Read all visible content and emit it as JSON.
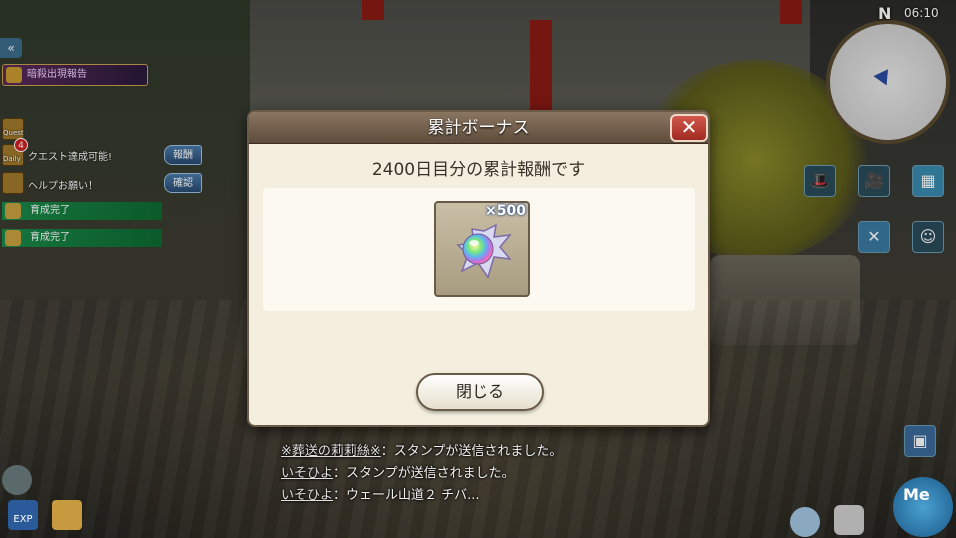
{
  "hud": {
    "clock": "06:10",
    "compass_label": "N",
    "collapse_glyph": "«",
    "event_banner": "暗殺出現報告",
    "quest_icon_label": "Quest",
    "daily_icon_label": "Daily",
    "daily_badge": "4",
    "quest_status": "クエスト達成可能!",
    "help_text": "ヘルプお願い！",
    "report_tag": "報酬",
    "confirm_tag": "確認",
    "training_items": [
      "育成完了",
      "育成完了"
    ],
    "exp_label": "EXP",
    "me_label": "Me"
  },
  "dialog": {
    "title": "累計ボーナス",
    "close_glyph": "✕",
    "subtitle": "2400日目分の累計報酬です",
    "reward": {
      "icon": "rainbow-gem-icon",
      "quantity": "×500"
    },
    "close_button": "閉じる"
  },
  "chat": [
    {
      "name": "※葬送の莉莉絲※",
      "text": "：スタンプが送信されました。"
    },
    {
      "name": "いそひよ",
      "text": "：スタンプが送信されました。"
    },
    {
      "name": "いそひよ",
      "text": "：ウェール山道２ チバ..."
    }
  ],
  "colors": {
    "dialog_bg": "#f3eedd",
    "header_bg": "#5e4c3c",
    "close_red": "#c0392b",
    "green_bar": "#1a8a4a"
  }
}
